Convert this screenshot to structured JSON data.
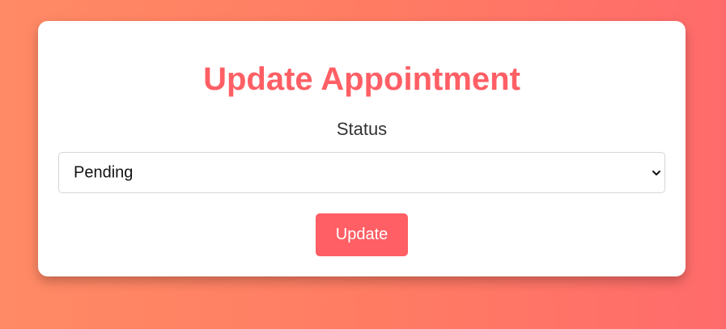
{
  "form": {
    "title": "Update Appointment",
    "status_label": "Status",
    "status_select": {
      "selected": "Pending"
    },
    "submit_label": "Update"
  },
  "colors": {
    "accent": "#ff5f65",
    "background_start": "#ff8a65",
    "background_end": "#ff6b6b",
    "card": "#ffffff"
  },
  "icons": {
    "select_arrow": "chevron-down-icon"
  }
}
